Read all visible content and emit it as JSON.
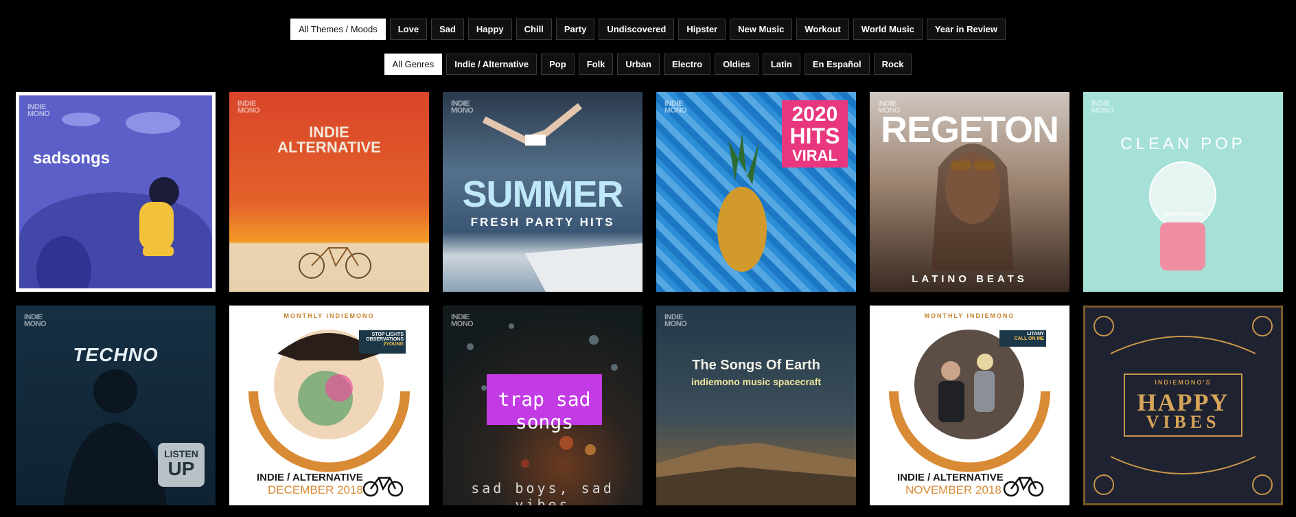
{
  "themes": {
    "items": [
      "All Themes / Moods",
      "Love",
      "Sad",
      "Happy",
      "Chill",
      "Party",
      "Undiscovered",
      "Hipster",
      "New Music",
      "Workout",
      "World Music",
      "Year in Review"
    ],
    "active_index": 0
  },
  "genres": {
    "items": [
      "All Genres",
      "Indie / Alternative",
      "Pop",
      "Folk",
      "Urban",
      "Electro",
      "Oldies",
      "Latin",
      "En Español",
      "Rock"
    ],
    "active_index": 0
  },
  "playlists": [
    {
      "logo": "INDIE MONO",
      "title": "sadsongs"
    },
    {
      "logo": "INDIE MONO",
      "title": "INDIE",
      "subtitle": "ALTERNATIVE"
    },
    {
      "logo": "INDIE MONO",
      "title": "SUMMER",
      "subtitle": "FRESH PARTY HITS"
    },
    {
      "logo": "INDIE MONO",
      "badge_year": "2020",
      "title": "HITS",
      "subtitle": "VIRAL"
    },
    {
      "logo": "INDIE MONO",
      "title": "REGETON",
      "subtitle": "LATINO BEATS"
    },
    {
      "logo": "INDIE MONO",
      "title": "CLEAN POP",
      "caption": "CANDY MACHINE"
    },
    {
      "logo": "INDIE MONO",
      "title": "TECHNO",
      "badge": "LISTEN",
      "badge2": "UP"
    },
    {
      "header": "MONTHLY INDIEMONO",
      "tag1": "STOP LIGHTS",
      "tag2": "OBSERVATIONS",
      "tag3": "2YOUNG",
      "title": "INDIE / ALTERNATIVE",
      "subtitle": "DECEMBER 2018"
    },
    {
      "logo": "INDIE MONO",
      "title": "trap sad songs",
      "subtitle": "sad boys, sad vibes"
    },
    {
      "logo": "INDIE MONO",
      "title": "The Songs Of Earth",
      "subtitle": "indiemono music spacecraft"
    },
    {
      "header": "MONTHLY INDIEMONO",
      "tag1": "LITANY",
      "tag2": "CALL ON ME",
      "title": "INDIE / ALTERNATIVE",
      "subtitle": "NOVEMBER 2018"
    },
    {
      "header": "INDIEMONO'S",
      "title": "HAPPY",
      "subtitle": "VIBES"
    }
  ]
}
